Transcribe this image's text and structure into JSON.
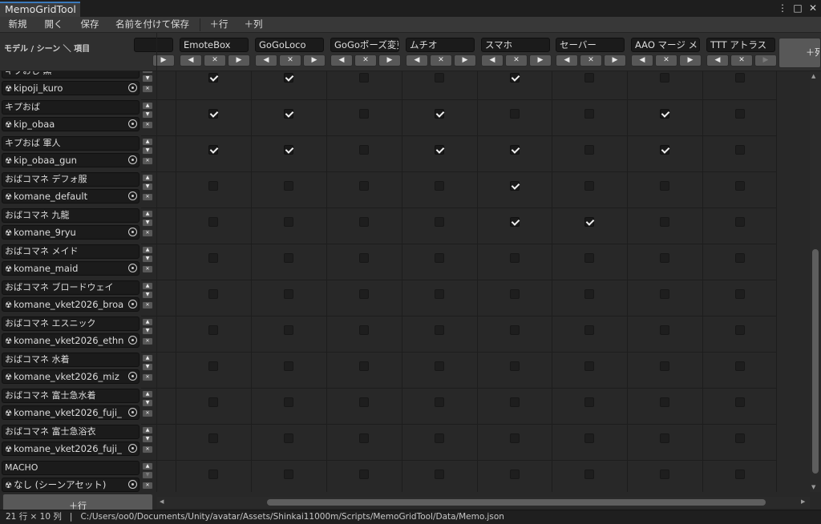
{
  "window": {
    "title": "MemoGridTool",
    "controls": [
      "⋮",
      "□",
      "✕"
    ]
  },
  "toolbar": {
    "new_label": "新規",
    "open_label": "開く",
    "save_label": "保存",
    "save_as_label": "名前を付けて保存",
    "add_row_label": "＋行",
    "add_col_label": "＋列"
  },
  "grid_header": {
    "corner_label": "モデル / シーン ＼ 項目",
    "add_col_label": "＋列",
    "columns": [
      {
        "name": ""
      },
      {
        "name": "EmoteBox"
      },
      {
        "name": "GoGoLoco"
      },
      {
        "name": "GoGoポーズ変更"
      },
      {
        "name": "ムチオ"
      },
      {
        "name": "スマホ"
      },
      {
        "name": "セーバー"
      },
      {
        "name": "AAO マージ メッシュ"
      },
      {
        "name": "TTT アトラス"
      }
    ],
    "btn_left": "◀",
    "btn_remove": "✕",
    "btn_right": "▶"
  },
  "rows": [
    {
      "name": "キプおじ 黒",
      "asset": "kipoji_kuro",
      "checks": [
        true,
        true,
        false,
        false,
        true,
        false,
        false,
        false
      ]
    },
    {
      "name": "キプおば",
      "asset": "kip_obaa",
      "checks": [
        true,
        true,
        false,
        true,
        false,
        false,
        true,
        false
      ]
    },
    {
      "name": "キプおば 軍人",
      "asset": "kip_obaa_gun",
      "checks": [
        true,
        true,
        false,
        true,
        true,
        false,
        true,
        false
      ]
    },
    {
      "name": "おばコマネ デフォ服",
      "asset": "komane_default",
      "checks": [
        false,
        false,
        false,
        false,
        true,
        false,
        false,
        false
      ]
    },
    {
      "name": "おばコマネ 九龍",
      "asset": "komane_9ryu",
      "checks": [
        false,
        false,
        false,
        false,
        true,
        true,
        false,
        false
      ]
    },
    {
      "name": "おばコマネ メイド",
      "asset": "komane_maid",
      "checks": [
        false,
        false,
        false,
        false,
        false,
        false,
        false,
        false
      ]
    },
    {
      "name": "おばコマネ ブロードウェイ",
      "asset": "komane_vket2026_broa",
      "checks": [
        false,
        false,
        false,
        false,
        false,
        false,
        false,
        false
      ]
    },
    {
      "name": "おばコマネ エスニック",
      "asset": "komane_vket2026_ethn",
      "checks": [
        false,
        false,
        false,
        false,
        false,
        false,
        false,
        false
      ]
    },
    {
      "name": "おばコマネ 水着",
      "asset": "komane_vket2026_miz",
      "checks": [
        false,
        false,
        false,
        false,
        false,
        false,
        false,
        false
      ]
    },
    {
      "name": "おばコマネ 富士急水着",
      "asset": "komane_vket2026_fuji_",
      "checks": [
        false,
        false,
        false,
        false,
        false,
        false,
        false,
        false
      ]
    },
    {
      "name": "おばコマネ 富士急浴衣",
      "asset": "komane_vket2026_fuji_",
      "checks": [
        false,
        false,
        false,
        false,
        false,
        false,
        false,
        false
      ]
    },
    {
      "name": "MACHO",
      "asset": "なし (シーンアセット)",
      "checks": [
        false,
        false,
        false,
        false,
        false,
        false,
        false,
        false
      ]
    }
  ],
  "row_controls": {
    "up": "▲",
    "down": "▼",
    "remove": "✕"
  },
  "add_row_button": "＋行",
  "status": {
    "dimensions": "21 行 × 10 列",
    "separator": "|",
    "path": "C:/Users/oo0/Documents/Unity/avatar/Assets/Shinkai11000m/Scripts/MemoGridTool/Data/Memo.json"
  },
  "icons": {
    "asset_icon": "unity-asset-icon",
    "target_icon": "object-picker-icon"
  },
  "colors": {
    "accent": "#3a79bb",
    "background": "#282828",
    "field": "#1b1b1b",
    "button": "#585858"
  }
}
